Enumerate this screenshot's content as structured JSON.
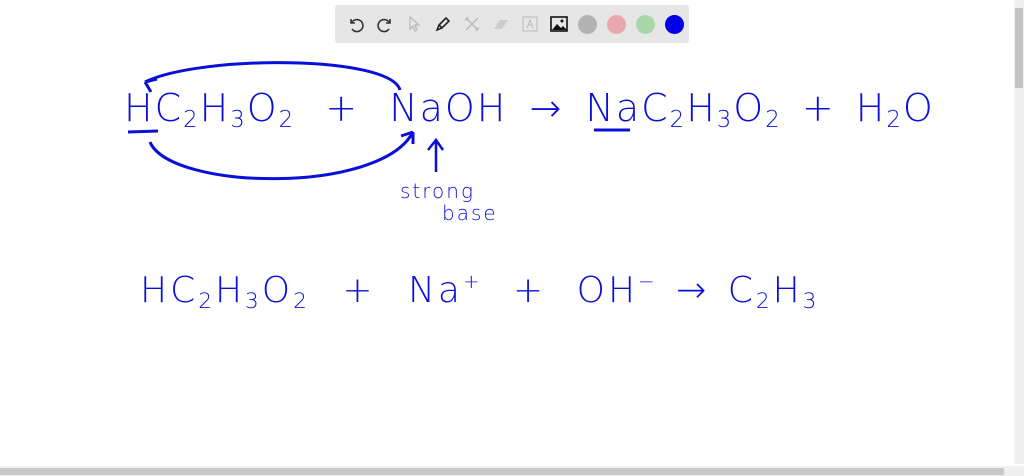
{
  "toolbar": {
    "tools": [
      "undo-icon",
      "redo-icon",
      "select-icon",
      "pen-icon",
      "tools-icon",
      "eraser-icon",
      "text-icon",
      "image-icon"
    ],
    "colors": [
      "#b3b3b3",
      "#e8a8ae",
      "#a8d8a8",
      "#0000e6"
    ],
    "active_color": "#0000e6"
  },
  "board": {
    "ink_color": "#0a10d8",
    "line1": {
      "reactant1": "HC",
      "r1_sub1": "2",
      "r1_mid": "H",
      "r1_sub2": "3",
      "r1_o": "O",
      "r1_sub3": "2",
      "plus1": "+",
      "reactant2": "NaOH",
      "arrow": "→",
      "product1": "NaC",
      "p1_sub1": "2",
      "p1_mid": "H",
      "p1_sub2": "3",
      "p1_o": "O",
      "p1_sub3": "2",
      "plus2": "+",
      "product2_h": "H",
      "product2_sub": "2",
      "product2_o": "O"
    },
    "annotation": {
      "line1": "strong",
      "line2": "base"
    },
    "line2": {
      "a": "HC",
      "a_sub1": "2",
      "a_mid": "H",
      "a_sub2": "3",
      "a_o": "O",
      "a_sub3": "2",
      "plus1": "+",
      "na": "Na",
      "na_sup": "+",
      "plus2": "+",
      "oh": "OH",
      "oh_sup": "−",
      "arrow": "→",
      "c": "C",
      "c_sub": "2",
      "h": "H",
      "h_sub": "3"
    }
  }
}
